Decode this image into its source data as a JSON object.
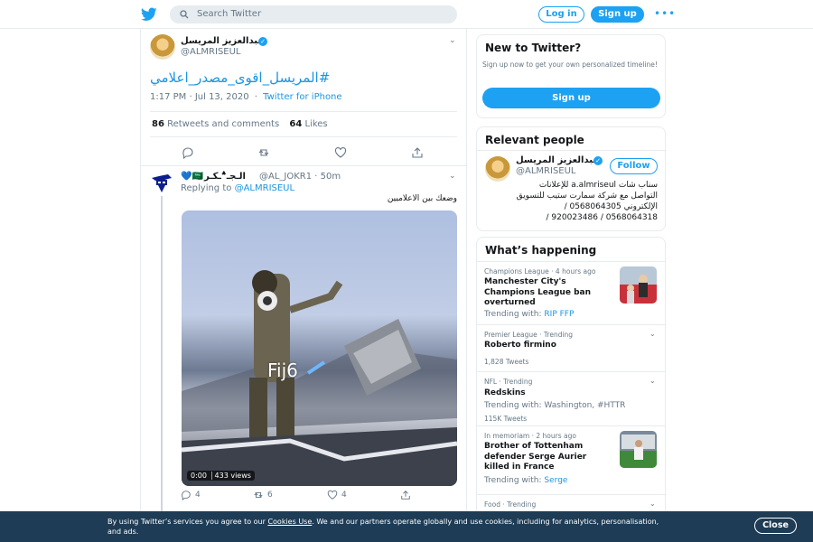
{
  "topbar": {
    "search_placeholder": "Search Twitter",
    "login_label": "Log in",
    "signup_label": "Sign up",
    "more_label": "•••"
  },
  "main_tweet": {
    "name": "عبدالعزيز المريسل",
    "handle": "@ALMRISEUL",
    "text": "#المريسل_اقوى_مصدر_اعلامي",
    "time": "1:17 PM · Jul 13, 2020",
    "source": "Twitter for iPhone",
    "retweets_count": "86",
    "retweets_label": "Retweets and comments",
    "likes_count": "64",
    "likes_label": "Likes"
  },
  "reply": {
    "name": "الـجـ؞ـكـر",
    "flags": "💙🇸🇦",
    "handle": "@AL_JOKR1 · 50m",
    "replying_prefix": "Replying to",
    "replying_to": "@ALMRISEUL",
    "text": "وضعك بين الاعلاميين",
    "video_label": "Fij6",
    "video_time": "0:00",
    "video_views": "433 views",
    "reply_count": "4",
    "retweet_count": "6",
    "like_count": "4"
  },
  "new_to_twitter": {
    "title": "New to Twitter?",
    "description": "Sign up now to get your own personalized timeline!",
    "button": "Sign up"
  },
  "relevant": {
    "title": "Relevant people",
    "name": "عبدالعزيز المريسل",
    "handle": "@ALMRISEUL",
    "follow": "Follow",
    "bio": "سناب شات a.almriseul للإعلانات التواصل مع شركة سمارت ستيب للتسويق الإلكتروني 0568064305 / 0568064318 / 920023486 /"
  },
  "trends": {
    "title": "What’s happening",
    "items": [
      {
        "meta": "Champions League · 4 hours ago",
        "name": "Manchester City's Champions League ban overturned",
        "with_prefix": "Trending with:",
        "with": "RIP FFP",
        "count": ""
      },
      {
        "meta": "Premier League · Trending",
        "name": "Roberto firmino",
        "with_prefix": "",
        "with": "",
        "count": "1,828 Tweets"
      },
      {
        "meta": "NFL · Trending",
        "name": "Redskins",
        "with_prefix": "Trending with: Washington, #HTTR",
        "with": "",
        "count": "115K Tweets"
      },
      {
        "meta": "In memoriam · 2 hours ago",
        "name": "Brother of Tottenham defender Serge Aurier killed in France",
        "with_prefix": "Trending with:",
        "with": "Serge",
        "count": ""
      },
      {
        "meta": "Food · Trending",
        "name": "",
        "with_prefix": "",
        "with": "",
        "count": ""
      }
    ]
  },
  "cookie": {
    "text_before": "By using Twitter’s services you agree to our",
    "link": "Cookies Use",
    "text_after": ". We and our partners operate globally and use cookies, including for analytics, personalisation, and ads.",
    "close": "Close"
  },
  "colors": {
    "brand": "#1da1f2",
    "link": "#1b95e0",
    "banner": "#1e3c55"
  }
}
